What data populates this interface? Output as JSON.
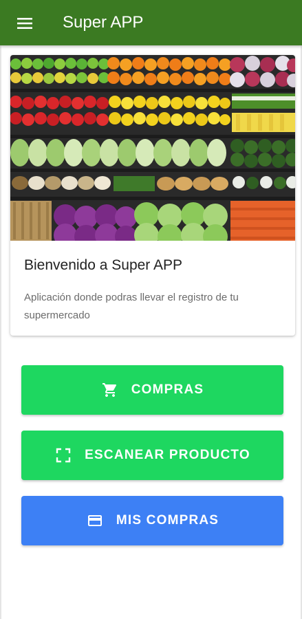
{
  "app": {
    "title": "Super APP"
  },
  "header": {
    "menu_icon": "menu-icon",
    "color": "#3b7a22"
  },
  "card": {
    "image_subject": "supermarket produce shelves",
    "title": "Bienvenido a Super APP",
    "description": "Aplicación donde podras llevar el registro de tu supermercado"
  },
  "buttons": [
    {
      "label": "COMPRAS",
      "icon": "cart-icon",
      "color": "#1ed760"
    },
    {
      "label": "ESCANEAR PRODUCTO",
      "icon": "scan-icon",
      "color": "#1ed760"
    },
    {
      "label": "MIS COMPRAS",
      "icon": "credit-card-icon",
      "color": "#3d80f5"
    }
  ]
}
